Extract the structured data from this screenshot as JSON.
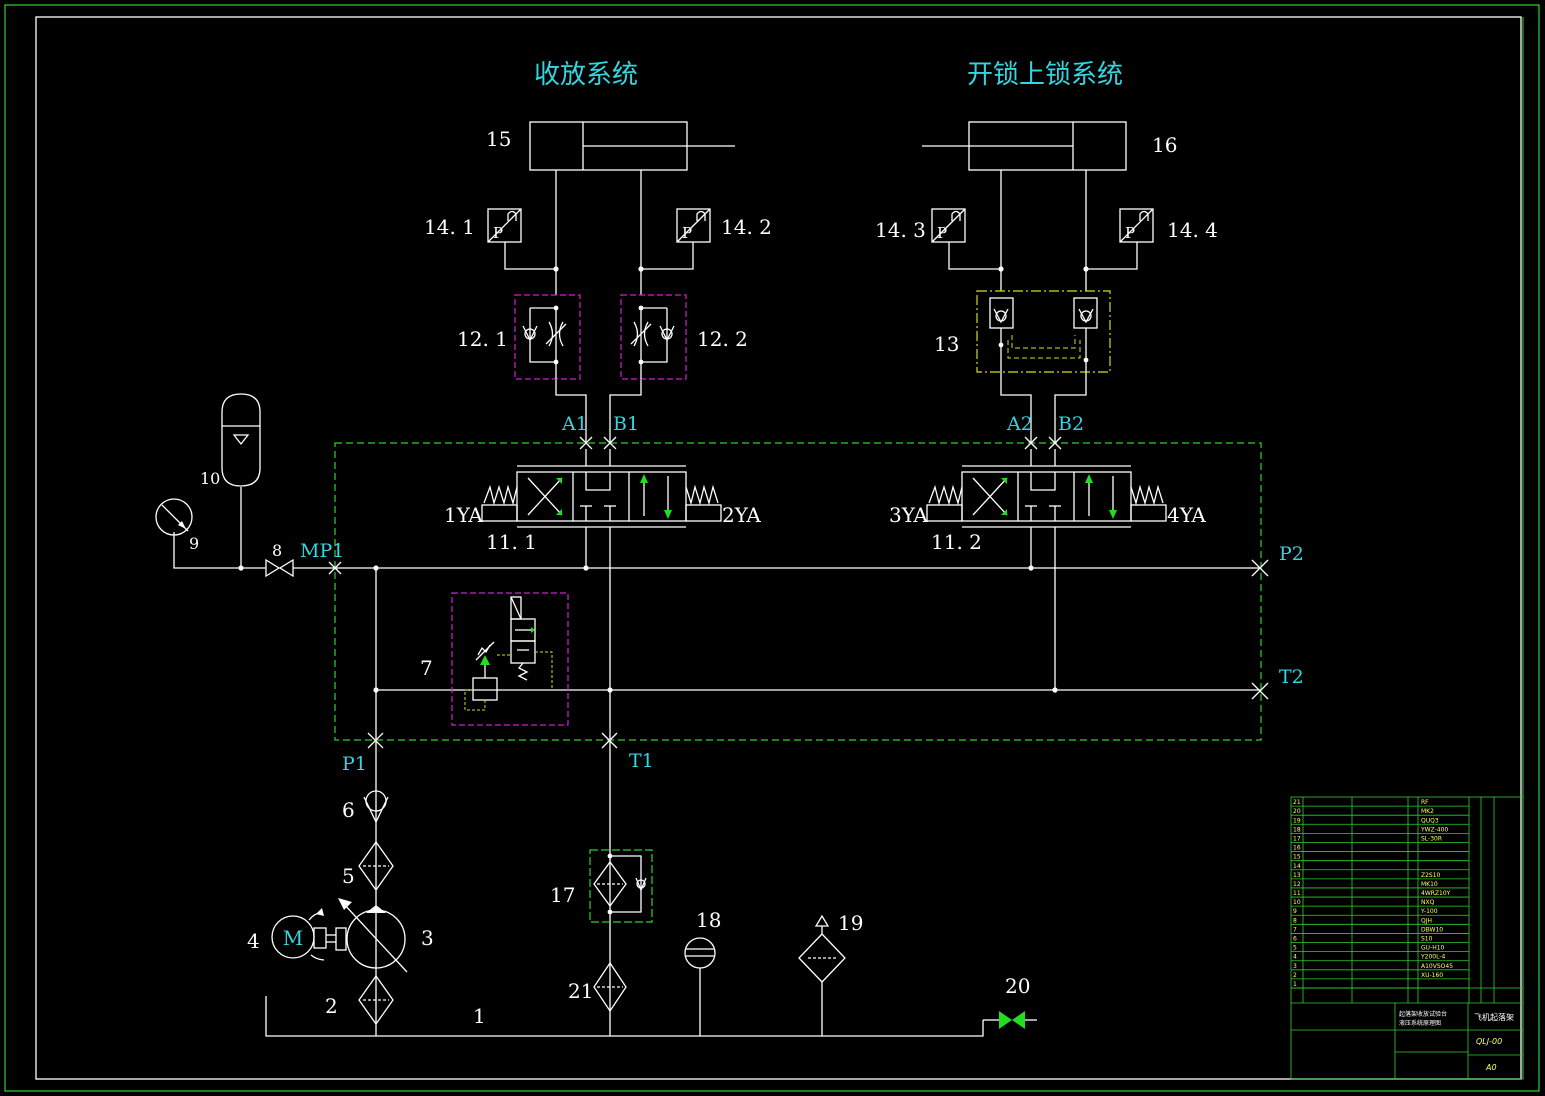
{
  "titles": {
    "retract_system": "收放系统",
    "lock_system": "开锁上锁系统"
  },
  "labels": {
    "n1": "1",
    "n2": "2",
    "n3": "3",
    "n4": "4",
    "n5": "5",
    "n6": "6",
    "n7": "7",
    "n8": "8",
    "n9": "9",
    "n10": "10",
    "n11_1": "11. 1",
    "n11_2": "11. 2",
    "n12_1": "12. 1",
    "n12_2": "12. 2",
    "n13": "13",
    "n14_1": "14. 1",
    "n14_2": "14. 2",
    "n14_3": "14. 3",
    "n14_4": "14. 4",
    "n15": "15",
    "n16": "16",
    "n17": "17",
    "n18": "18",
    "n19": "19",
    "n20": "20",
    "n21": "21",
    "motor": "M",
    "pressure_switch": "P"
  },
  "ports": {
    "a1": "A1",
    "b1": "B1",
    "a2": "A2",
    "b2": "B2",
    "mp1": "MP1",
    "p1": "P1",
    "t1": "T1",
    "p2": "P2",
    "t2": "T2"
  },
  "solenoids": {
    "s1": "1YA",
    "s2": "2YA",
    "s3": "3YA",
    "s4": "4YA"
  },
  "title_block": {
    "drawing_title": "飞机起落架",
    "drawing_code": "QLJ-00",
    "sheet_size": "A0",
    "design_title_line1": "起落架收放试验台",
    "design_title_line2": "液压系统原理图",
    "bom_rows": [
      {
        "no": "21",
        "code": "RF"
      },
      {
        "no": "20",
        "code": "MK2"
      },
      {
        "no": "19",
        "code": "QUQ3"
      },
      {
        "no": "18",
        "code": "YWZ-400"
      },
      {
        "no": "17",
        "code": "SL-30R"
      },
      {
        "no": "16",
        "code": ""
      },
      {
        "no": "15",
        "code": ""
      },
      {
        "no": "14",
        "code": ""
      },
      {
        "no": "13",
        "code": "Z2S10"
      },
      {
        "no": "12",
        "code": "MK10"
      },
      {
        "no": "11",
        "code": "4WRZ10Y"
      },
      {
        "no": "10",
        "code": "NXQ"
      },
      {
        "no": "9",
        "code": "Y-100"
      },
      {
        "no": "8",
        "code": "QJH"
      },
      {
        "no": "7",
        "code": "DBW10"
      },
      {
        "no": "6",
        "code": "S10"
      },
      {
        "no": "5",
        "code": "GU-H10"
      },
      {
        "no": "4",
        "code": "Y200L-4"
      },
      {
        "no": "3",
        "code": "A10VSO45"
      },
      {
        "no": "2",
        "code": "XU-160"
      },
      {
        "no": "1",
        "code": ""
      }
    ]
  },
  "colors": {
    "line": "#ffffff",
    "text_cyan": "#33d6e0",
    "boundary_green": "#2fd02f",
    "valve_magenta": "#d020d0",
    "valve_yellow": "#d8d820",
    "arrow_green": "#22dd22"
  }
}
